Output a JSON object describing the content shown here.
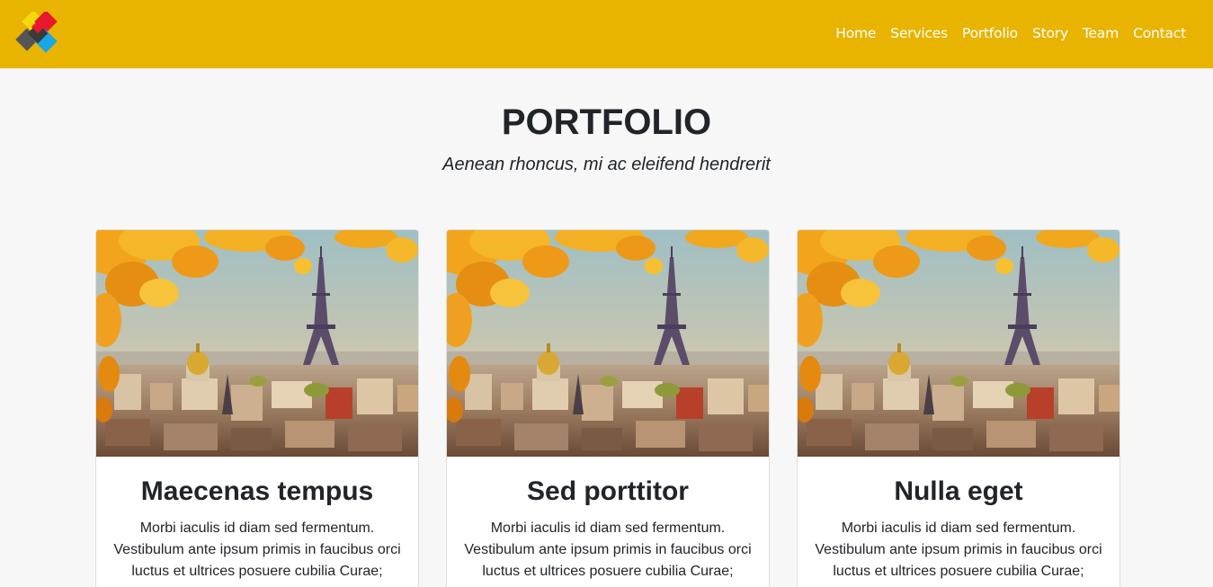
{
  "brand": {
    "logo_icon": "colored-squares-logo-icon",
    "colors": [
      "#f5d90a",
      "#e8192c",
      "#555555",
      "#1aa7e6"
    ]
  },
  "nav": {
    "items": [
      {
        "label": "Home"
      },
      {
        "label": "Services"
      },
      {
        "label": "Portfolio"
      },
      {
        "label": "Story"
      },
      {
        "label": "Team"
      },
      {
        "label": "Contact"
      }
    ]
  },
  "portfolio": {
    "title": "PORTFOLIO",
    "subtitle": "Aenean rhoncus, mi ac eleifend hendrerit",
    "cards": [
      {
        "image": "paris-eiffel-tower-autumn-photo",
        "title": "Maecenas tempus",
        "text": "Morbi iaculis id diam sed fermentum. Vestibulum ante ipsum primis in faucibus orci luctus et ultrices posuere cubilia Curae;"
      },
      {
        "image": "paris-eiffel-tower-autumn-photo",
        "title": "Sed porttitor",
        "text": "Morbi iaculis id diam sed fermentum. Vestibulum ante ipsum primis in faucibus orci luctus et ultrices posuere cubilia Curae;"
      },
      {
        "image": "paris-eiffel-tower-autumn-photo",
        "title": "Nulla eget",
        "text": "Morbi iaculis id diam sed fermentum. Vestibulum ante ipsum primis in faucibus orci luctus et ultrices posuere cubilia Curae;"
      }
    ]
  },
  "theme": {
    "navbar_bg": "#e8b400",
    "page_bg": "#f7f7f7",
    "text": "#212529"
  }
}
